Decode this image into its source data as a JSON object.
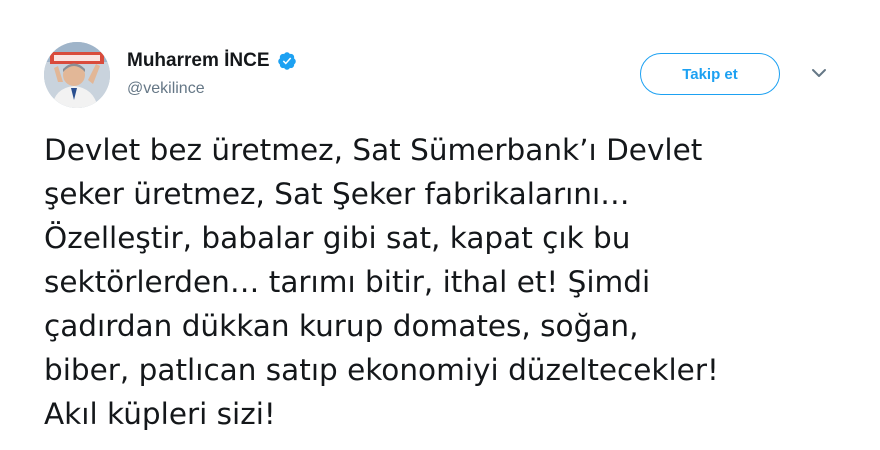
{
  "author": {
    "display_name": "Muharrem İNCE",
    "handle": "@vekilince",
    "verified_icon": "verified-badge-icon",
    "avatar_icon": "profile-photo"
  },
  "actions": {
    "follow_label": "Takip et",
    "more_icon": "chevron-down-icon"
  },
  "tweet": {
    "lines": [
      "Devlet bez üretmez, Sat Sümerbank’ı Devlet",
      "şeker üretmez, Sat Şeker fabrikalarını…",
      "Özelleştir, babalar gibi sat, kapat çık bu",
      "sektörlerden… tarımı bitir, ithal et! Şimdi",
      "çadırdan dükkan kurup domates, soğan,",
      "biber, patlıcan satıp ekonomiyi düzeltecekler!",
      "Akıl küpleri sizi!"
    ]
  },
  "colors": {
    "accent": "#1da1f2",
    "text": "#14171a",
    "secondary": "#657786"
  }
}
